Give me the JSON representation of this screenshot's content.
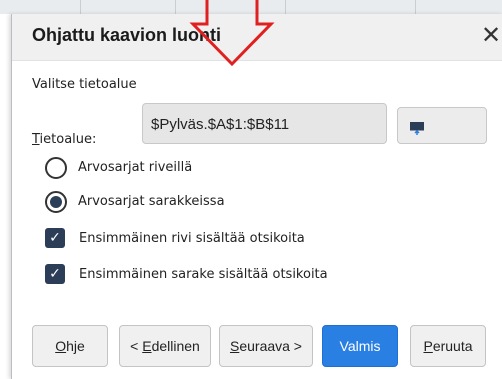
{
  "dialog": {
    "title": "Ohjattu kaavion luonti",
    "close_glyph": "✕"
  },
  "data_range": {
    "section_title": "Valitse tietoalue",
    "range_label_first": "T",
    "range_label_rest": "ietoalue:",
    "range_value": "$Pylväs.$A$1:$B$11",
    "shrink_icon": "shrink-dialog-icon"
  },
  "series_options": {
    "rows_label": "Arvosarjat riveillä",
    "columns_label": "Arvosarjat sarakkeissa",
    "selected": "columns"
  },
  "checkboxes": {
    "first_row_label": "Ensimmäinen rivi sisältää otsikoita",
    "first_row_checked": true,
    "first_col_label": "Ensimmäinen sarake sisältää otsikoita",
    "first_col_checked": true
  },
  "buttons": {
    "help_u": "O",
    "help_rest": "hje",
    "back_prefix": "< ",
    "back_u": "E",
    "back_rest": "dellinen",
    "next_u": "S",
    "next_rest": "euraava >",
    "finish": "Valmis",
    "cancel_u": "P",
    "cancel_rest": "eruuta"
  },
  "colors": {
    "primary_button": "#2a7fe3",
    "arrow": "#e02020",
    "checkbox": "#2c3d58"
  }
}
